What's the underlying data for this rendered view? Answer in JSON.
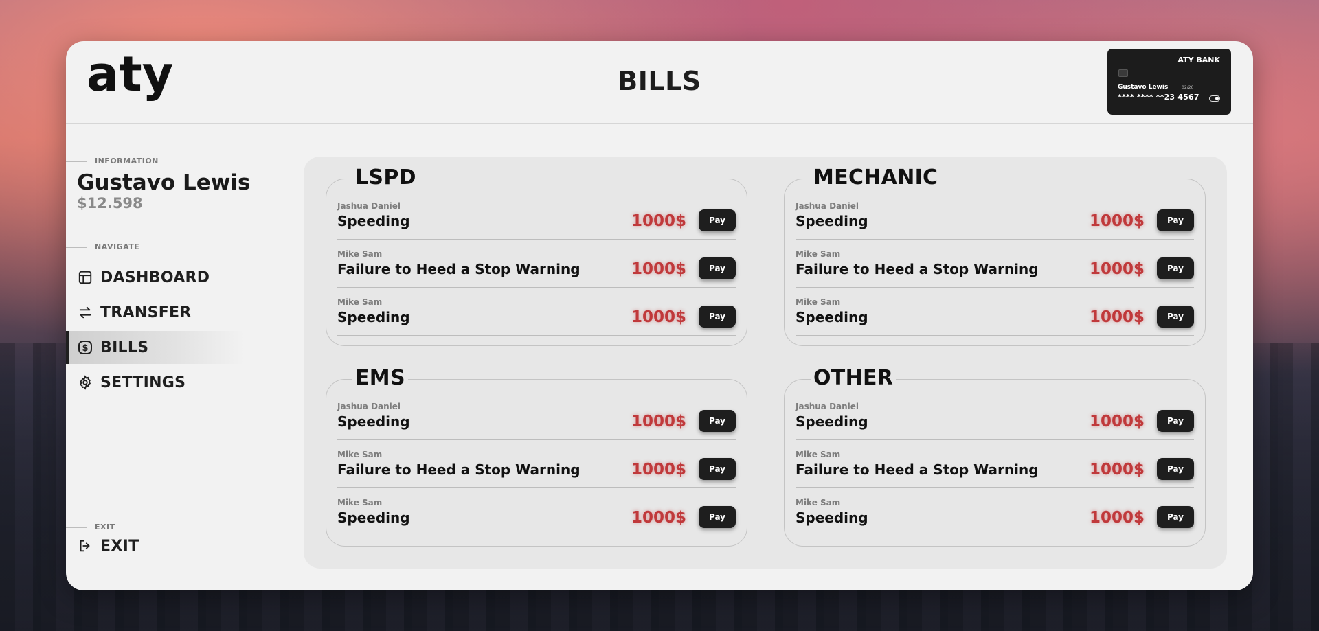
{
  "app": {
    "logo_text": "aty",
    "page_title": "BILLS"
  },
  "card": {
    "bank_name": "ATY BANK",
    "holder": "Gustavo Lewis",
    "expiry": "02/26",
    "number": "**** **** **23 4567"
  },
  "sidebar": {
    "info_label": "INFORMATION",
    "user_name": "Gustavo Lewis",
    "balance": "$12.598",
    "navigate_label": "NAVIGATE",
    "items": [
      {
        "label": "DASHBOARD",
        "icon": "layout-icon"
      },
      {
        "label": "TRANSFER",
        "icon": "arrows-icon"
      },
      {
        "label": "BILLS",
        "icon": "dollar-icon"
      },
      {
        "label": "SETTINGS",
        "icon": "gear-icon"
      }
    ],
    "exit_label": "EXIT",
    "exit_item": "EXIT"
  },
  "groups": [
    {
      "title": "LSPD",
      "bills": [
        {
          "issuer": "Jashua Daniel",
          "reason": "Speeding",
          "amount": "1000$",
          "pay": "Pay"
        },
        {
          "issuer": "Mike Sam",
          "reason": "Failure to Heed a Stop Warning",
          "amount": "1000$",
          "pay": "Pay"
        },
        {
          "issuer": "Mike Sam",
          "reason": "Speeding",
          "amount": "1000$",
          "pay": "Pay"
        }
      ]
    },
    {
      "title": "MECHANIC",
      "bills": [
        {
          "issuer": "Jashua Daniel",
          "reason": "Speeding",
          "amount": "1000$",
          "pay": "Pay"
        },
        {
          "issuer": "Mike Sam",
          "reason": "Failure to Heed a Stop Warning",
          "amount": "1000$",
          "pay": "Pay"
        },
        {
          "issuer": "Mike Sam",
          "reason": "Speeding",
          "amount": "1000$",
          "pay": "Pay"
        }
      ]
    },
    {
      "title": "EMS",
      "bills": [
        {
          "issuer": "Jashua Daniel",
          "reason": "Speeding",
          "amount": "1000$",
          "pay": "Pay"
        },
        {
          "issuer": "Mike Sam",
          "reason": "Failure to Heed a Stop Warning",
          "amount": "1000$",
          "pay": "Pay"
        },
        {
          "issuer": "Mike Sam",
          "reason": "Speeding",
          "amount": "1000$",
          "pay": "Pay"
        }
      ]
    },
    {
      "title": "OTHER",
      "bills": [
        {
          "issuer": "Jashua Daniel",
          "reason": "Speeding",
          "amount": "1000$",
          "pay": "Pay"
        },
        {
          "issuer": "Mike Sam",
          "reason": "Failure to Heed a Stop Warning",
          "amount": "1000$",
          "pay": "Pay"
        },
        {
          "issuer": "Mike Sam",
          "reason": "Speeding",
          "amount": "1000$",
          "pay": "Pay"
        }
      ]
    }
  ],
  "colors": {
    "amount": "#c0393b",
    "pay_button": "#1e1e1e",
    "panel": "#f2f2f2"
  }
}
